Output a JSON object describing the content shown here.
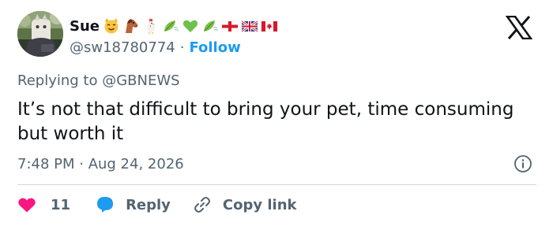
{
  "colors": {
    "text_primary": "#0f1419",
    "text_secondary": "#536471",
    "accent_blue": "#1d9bf0",
    "like_pink": "#f91880",
    "divider": "#cfd9de"
  },
  "author": {
    "display_name": "Sue",
    "name_emojis": [
      "cat-face-emoji",
      "horse-face-emoji",
      "rooster-emoji",
      "leaf-fluttering-emoji",
      "green-heart-emoji",
      "leaf-fluttering-emoji",
      "england-flag-emoji",
      "uk-flag-emoji",
      "canada-flag-emoji"
    ],
    "handle": "@sw18780774",
    "separator": "·",
    "follow_label": "Follow"
  },
  "tweet": {
    "reply_to": "Replying to @GBNEWS",
    "text": "It’s not that difficult to bring your pet, time consuming but worth it",
    "timestamp": "7:48 PM · Aug 24, 2026"
  },
  "actions": {
    "like_count": "11",
    "reply_label": "Reply",
    "copy_link_label": "Copy link"
  },
  "icons": {
    "brand": "x-logo-icon",
    "info": "info-circle-icon",
    "like": "heart-icon",
    "reply": "speech-bubble-icon",
    "copy": "link-icon"
  }
}
